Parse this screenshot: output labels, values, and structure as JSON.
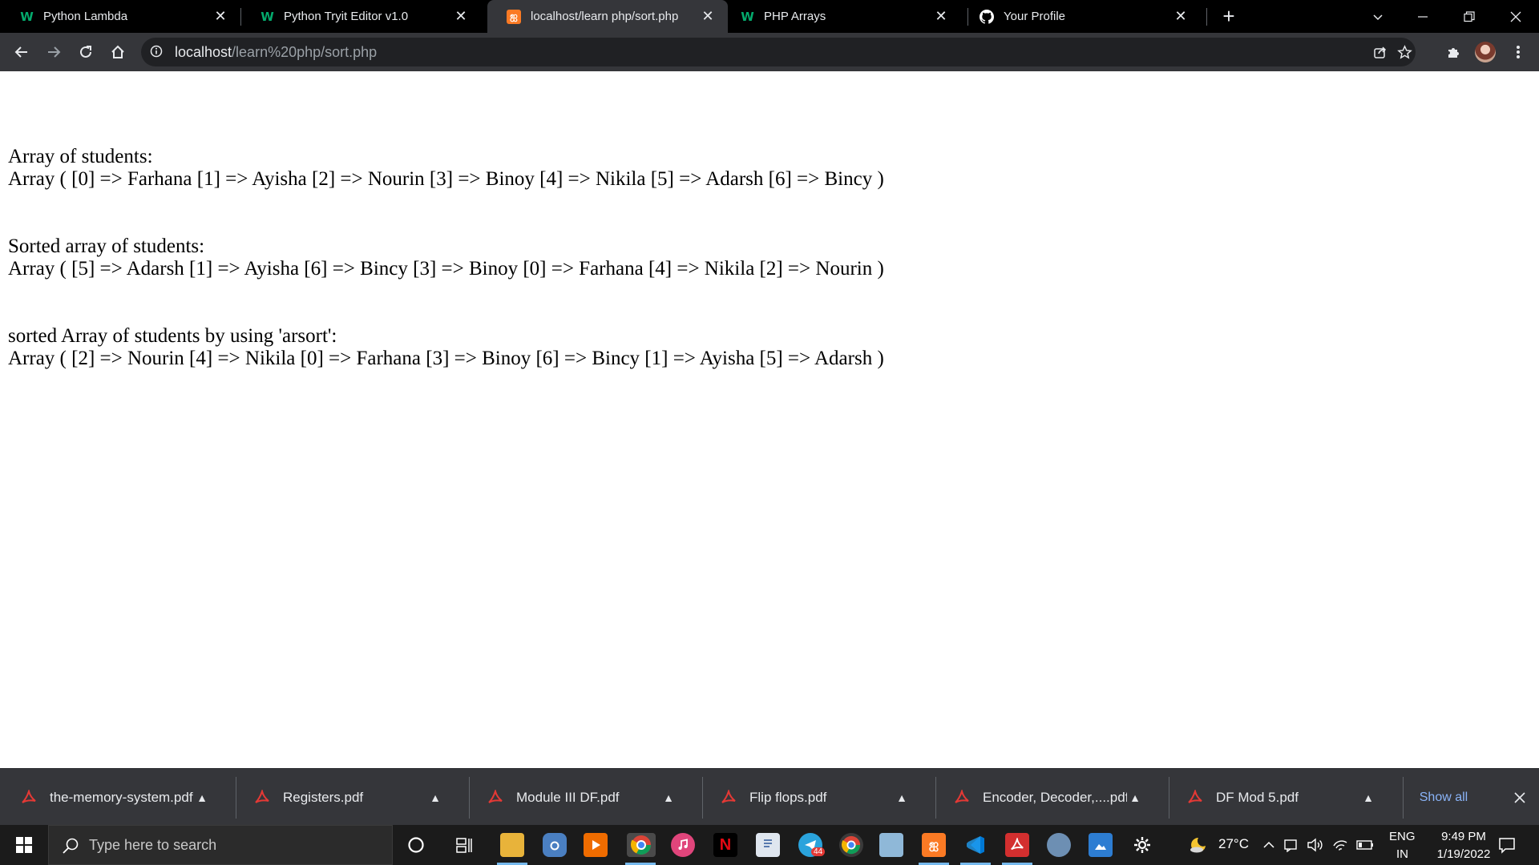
{
  "browser": {
    "tabs": [
      {
        "title": "Python Lambda",
        "favicon": "w3schools-icon",
        "active": false
      },
      {
        "title": "Python Tryit Editor v1.0",
        "favicon": "w3schools-icon",
        "active": false
      },
      {
        "title": "localhost/learn php/sort.php",
        "favicon": "xampp-icon",
        "active": true
      },
      {
        "title": "PHP Arrays",
        "favicon": "w3schools-icon",
        "active": false
      },
      {
        "title": "Your Profile",
        "favicon": "github-icon",
        "active": false
      }
    ],
    "w3_glyph": "W",
    "xampp_glyph": "ஐ",
    "new_tab_label": "+",
    "url_host": "localhost",
    "url_path": "/learn%20php/sort.php"
  },
  "page": {
    "sections": [
      {
        "heading": "Array of students:",
        "line": "Array ( [0] => Farhana [1] => Ayisha [2] => Nourin [3] => Binoy [4] => Nikila [5] => Adarsh [6] => Bincy )"
      },
      {
        "heading": "Sorted array of students:",
        "line": "Array ( [5] => Adarsh [1] => Ayisha [6] => Bincy [3] => Binoy [0] => Farhana [4] => Nikila [2] => Nourin )"
      },
      {
        "heading": "sorted Array of students by using 'arsort':",
        "line": "Array ( [2] => Nourin [4] => Nikila [0] => Farhana [3] => Binoy [6] => Bincy [1] => Ayisha [5] => Adarsh )"
      }
    ]
  },
  "downloads": {
    "items": [
      {
        "name": "the-memory-system.pdf"
      },
      {
        "name": "Registers.pdf"
      },
      {
        "name": "Module III DF.pdf"
      },
      {
        "name": "Flip flops.pdf"
      },
      {
        "name": "Encoder, Decoder,....pdf"
      },
      {
        "name": "DF Mod 5.pdf"
      }
    ],
    "show_all_label": "Show all"
  },
  "taskbar": {
    "search_placeholder": "Type here to search",
    "temperature": "27°C",
    "language_top": "ENG",
    "language_bottom": "IN",
    "time": "9:49 PM",
    "date": "1/19/2022",
    "telegram_badge": "44",
    "netflix_glyph": "N",
    "xampp_glyph": "ஐ"
  }
}
